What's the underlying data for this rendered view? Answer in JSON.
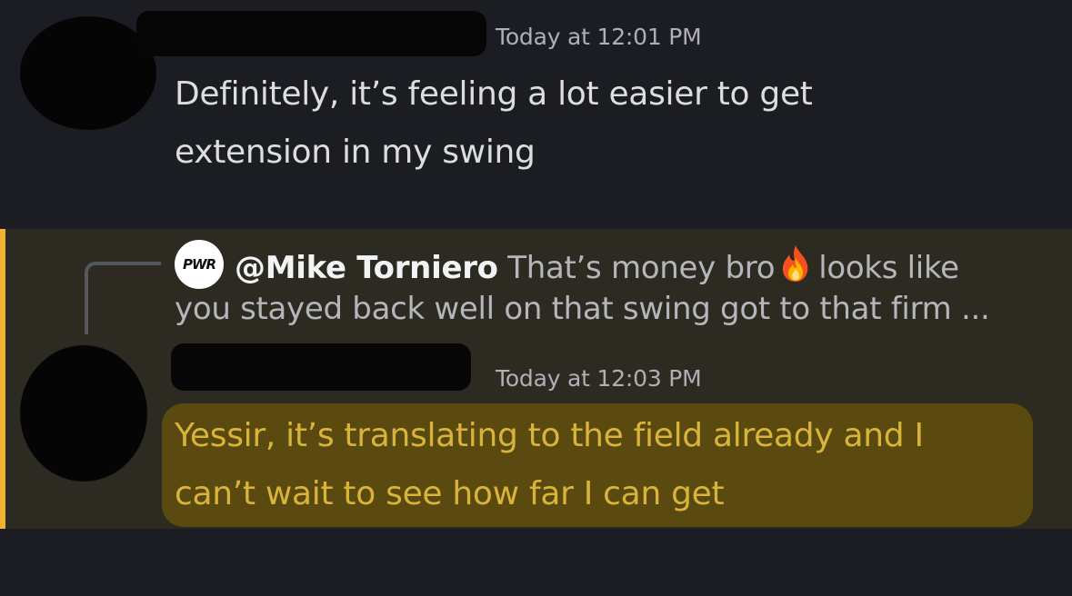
{
  "message_1": {
    "timestamp": "Today at 12:01 PM",
    "lines": [
      "Definitely, it’s feeling a lot easier to get",
      "extension in my swing"
    ]
  },
  "message_2": {
    "reply": {
      "avatar_text": "PWR",
      "author": "@Mike Torniero",
      "preview_part1": "That’s money bro",
      "preview_part2": "looks like",
      "preview_line2": "you stayed back well on that swing got to that firm ..."
    },
    "timestamp": "Today at 12:03 PM",
    "lines": [
      "Yessir, it’s translating to the field already and I",
      "can’t wait to see how far I can get"
    ]
  },
  "colors": {
    "background": "#1c1d23",
    "mention_background": "#2d2a22",
    "mention_bar": "#f0b232",
    "highlight_text": "#d8b43a"
  },
  "icons": [
    "fire-icon",
    "pwr-avatar-icon"
  ]
}
